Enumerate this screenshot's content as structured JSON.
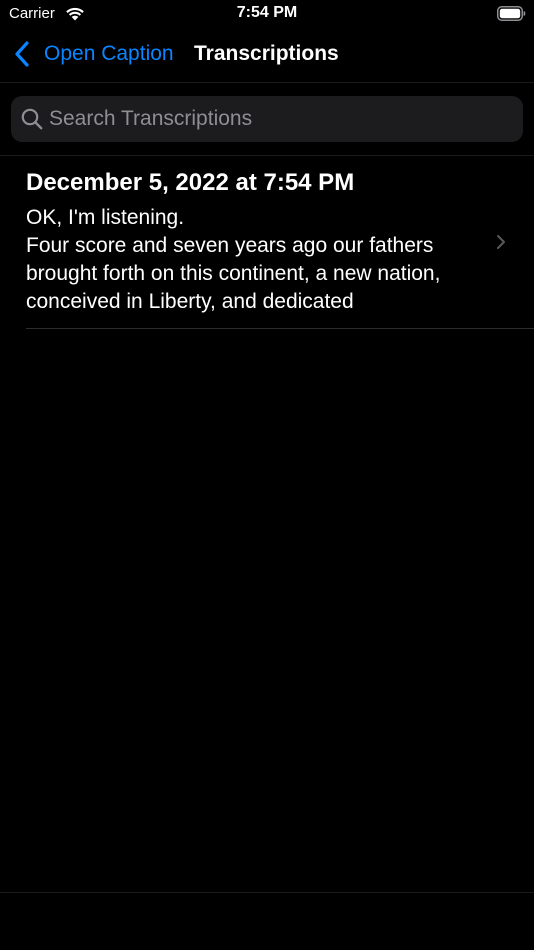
{
  "status_bar": {
    "carrier": "Carrier",
    "time": "7:54 PM"
  },
  "nav": {
    "back_label": "Open Caption",
    "title": "Transcriptions"
  },
  "search": {
    "placeholder": "Search Transcriptions",
    "value": ""
  },
  "transcriptions": [
    {
      "date": "December 5, 2022 at 7:54 PM",
      "preview": "OK, I'm listening.\nFour score and seven years ago our fathers brought forth on this continent, a new nation, conceived in Liberty, and dedicated"
    }
  ],
  "colors": {
    "background": "#000000",
    "accent": "#0a84ff",
    "search_background": "#1c1c1e",
    "placeholder": "#8e8e93"
  },
  "icons": {
    "wifi": "wifi-icon",
    "battery": "battery-icon",
    "back": "chevron-left-icon",
    "search": "magnifying-glass-icon",
    "disclosure": "chevron-right-icon"
  }
}
